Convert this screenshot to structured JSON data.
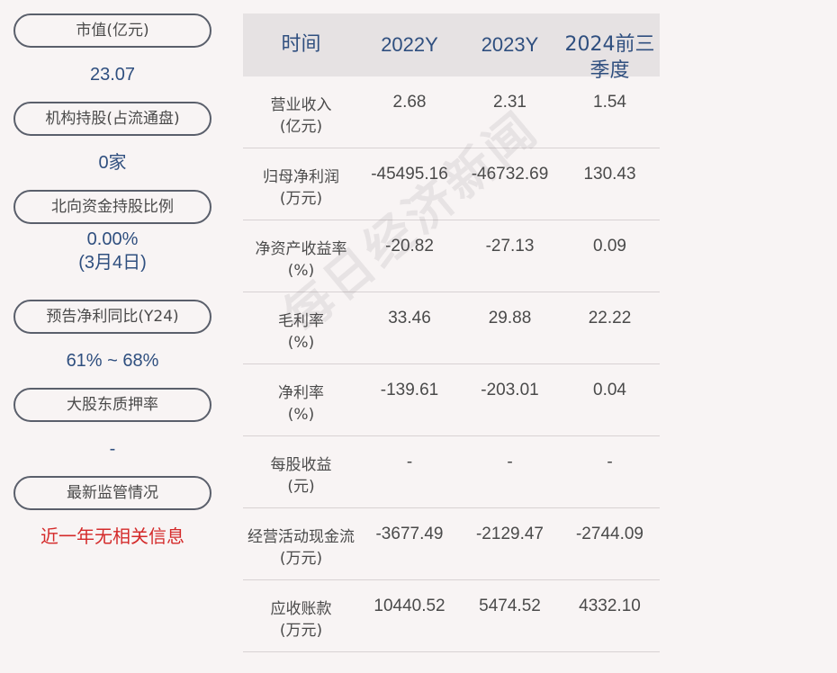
{
  "sidebar": {
    "items": [
      {
        "label": "市值(亿元)",
        "value": "23.07"
      },
      {
        "label": "机构持股(占流通盘)",
        "value": "0家"
      },
      {
        "label": "北向资金持股比例",
        "value_line1": "0.00%",
        "value_line2": "(3月4日)"
      },
      {
        "label": "预告净利同比(Y24)",
        "value": "61% ~ 68%"
      },
      {
        "label": "大股东质押率",
        "value": "-"
      },
      {
        "label": "最新监管情况",
        "value": "近一年无相关信息"
      }
    ]
  },
  "table": {
    "headers": {
      "label": "时间",
      "col1": "2022Y",
      "col2": "2023Y",
      "col3_line1": "2024前三",
      "col3_line2": "季度"
    },
    "rows": [
      {
        "label1": "营业收入",
        "label2": "(亿元)",
        "v1": "2.68",
        "v2": "2.31",
        "v3": "1.54"
      },
      {
        "label1": "归母净利润",
        "label2": "(万元)",
        "v1": "-45495.16",
        "v2": "-46732.69",
        "v3": "130.43"
      },
      {
        "label1": "净资产收益率",
        "label2": "(%)",
        "v1": "-20.82",
        "v2": "-27.13",
        "v3": "0.09"
      },
      {
        "label1": "毛利率",
        "label2": "(%)",
        "v1": "33.46",
        "v2": "29.88",
        "v3": "22.22"
      },
      {
        "label1": "净利率",
        "label2": "(%)",
        "v1": "-139.61",
        "v2": "-203.01",
        "v3": "0.04"
      },
      {
        "label1": "每股收益",
        "label2": "(元)",
        "v1": "-",
        "v2": "-",
        "v3": "-"
      },
      {
        "label1": "经营活动现金流",
        "label2": "(万元)",
        "v1": "-3677.49",
        "v2": "-2129.47",
        "v3": "-2744.09"
      },
      {
        "label1": "应收账款",
        "label2": "(万元)",
        "v1": "10440.52",
        "v2": "5474.52",
        "v3": "4332.10"
      }
    ]
  },
  "watermark": "每日经济新闻",
  "colors": {
    "background": "#f8f4f4",
    "value_blue": "#2f4f7f",
    "alert_red": "#d42a2a",
    "header_bg": "#e6e2e3"
  }
}
